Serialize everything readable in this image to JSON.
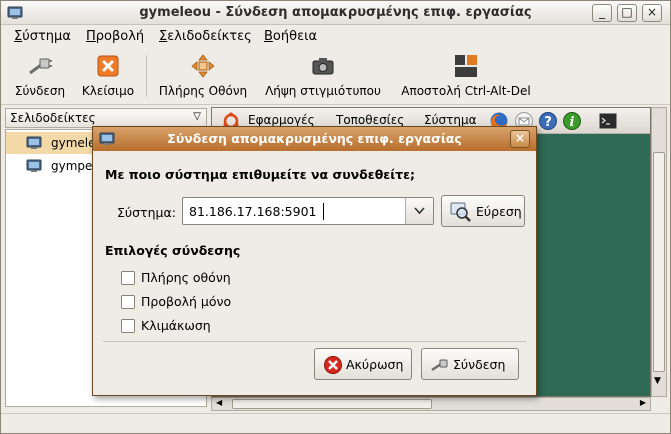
{
  "window": {
    "title": "gymeleou - Σύνδεση απομακρυσμένης επιφ. εργασίας",
    "minimize_glyph": "_",
    "maximize_glyph": "□",
    "close_glyph": "×"
  },
  "menubar": {
    "items": [
      {
        "first": "Σ",
        "rest": "ύστημα"
      },
      {
        "first": "Π",
        "rest": "ροβολή"
      },
      {
        "first": "Σ",
        "rest": "ελιδοδείκτες"
      },
      {
        "first": "Β",
        "rest": "οήθεια"
      }
    ]
  },
  "toolbar": {
    "connect": "Σύνδεση",
    "close": "Κλείσιμο",
    "fullscreen": "Πλήρης Οθόνη",
    "screenshot": "Λήψη στιγμιότυπου",
    "send_cad": "Αποστολή Ctrl-Alt-Del"
  },
  "sidebar": {
    "header": "Σελιδοδείκτες",
    "items": [
      {
        "label": "gymeleou"
      },
      {
        "label": "gympeg"
      }
    ]
  },
  "remote_panel": {
    "applications": "Εφαρμογές",
    "places": "Τοποθεσίες",
    "system": "Σύστημα"
  },
  "dialog": {
    "title": "Σύνδεση απομακρυσμένης επιφ. εργασίας",
    "close_glyph": "×",
    "question": "Με ποιο σύστημα επιθυμείτε να συνδεθείτε;",
    "system_label": "Σύστημα:",
    "system_value": "81.186.17.168:5901",
    "find_button": "Εύρεση",
    "options_heading": "Επιλογές σύνδεσης",
    "options": [
      {
        "label": "Πλήρης οθόνη",
        "checked": false
      },
      {
        "label": "Προβολή μόνο",
        "checked": false
      },
      {
        "label": "Κλιμάκωση",
        "checked": false
      }
    ],
    "cancel_button": "Ακύρωση",
    "connect_button": "Σύνδεση"
  },
  "colors": {
    "dialog_title": "#b86f2d",
    "remote_desktop": "#2f6a56",
    "selection": "#f4d9a8"
  }
}
